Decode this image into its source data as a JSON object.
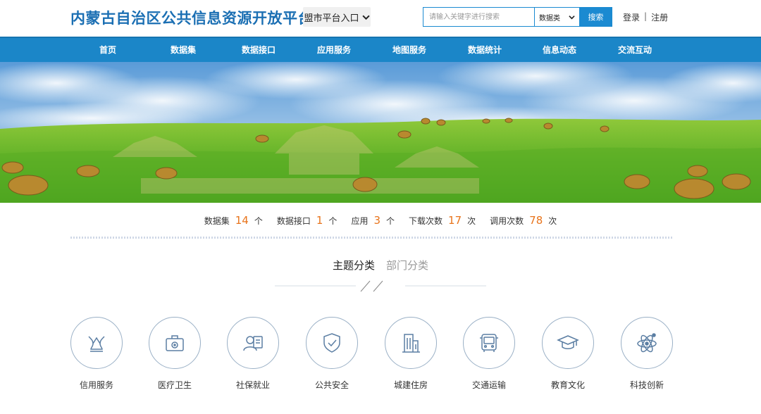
{
  "header": {
    "site_title": "内蒙古自治区公共信息资源开放平台",
    "city_entry_label": "盟市平台入口",
    "search": {
      "placeholder": "请输入关键字进行搜索",
      "category_selected": "数据类",
      "button_label": "搜索"
    },
    "auth": {
      "login": "登录",
      "separator": "|",
      "register": "注册"
    }
  },
  "nav": {
    "items": [
      {
        "label": "首页"
      },
      {
        "label": "数据集"
      },
      {
        "label": "数据接口"
      },
      {
        "label": "应用服务"
      },
      {
        "label": "地图服务"
      },
      {
        "label": "数据统计"
      },
      {
        "label": "信息动态"
      },
      {
        "label": "交流互动"
      }
    ]
  },
  "stats": {
    "datasets": {
      "label": "数据集",
      "value": "14",
      "unit": "个"
    },
    "apis": {
      "label": "数据接口",
      "value": "1",
      "unit": "个"
    },
    "apps": {
      "label": "应用",
      "value": "3",
      "unit": "个"
    },
    "downloads": {
      "label": "下载次数",
      "value": "17",
      "unit": "次"
    },
    "calls": {
      "label": "调用次数",
      "value": "78",
      "unit": "次"
    }
  },
  "tabs": {
    "active": "主题分类",
    "inactive": "部门分类"
  },
  "categories": [
    {
      "label": "信用服务",
      "icon": "shield-flower-icon"
    },
    {
      "label": "医疗卫生",
      "icon": "medical-kit-icon"
    },
    {
      "label": "社保就业",
      "icon": "person-card-icon"
    },
    {
      "label": "公共安全",
      "icon": "shield-check-icon"
    },
    {
      "label": "城建住房",
      "icon": "building-icon"
    },
    {
      "label": "交通运输",
      "icon": "bus-icon"
    },
    {
      "label": "教育文化",
      "icon": "graduation-cap-icon"
    },
    {
      "label": "科技创新",
      "icon": "atom-icon"
    }
  ],
  "colors": {
    "brand": "#1b6fb3",
    "nav_bg": "#1b86c8",
    "accent_number": "#e8741c",
    "icon_stroke": "#5b7ea3"
  }
}
